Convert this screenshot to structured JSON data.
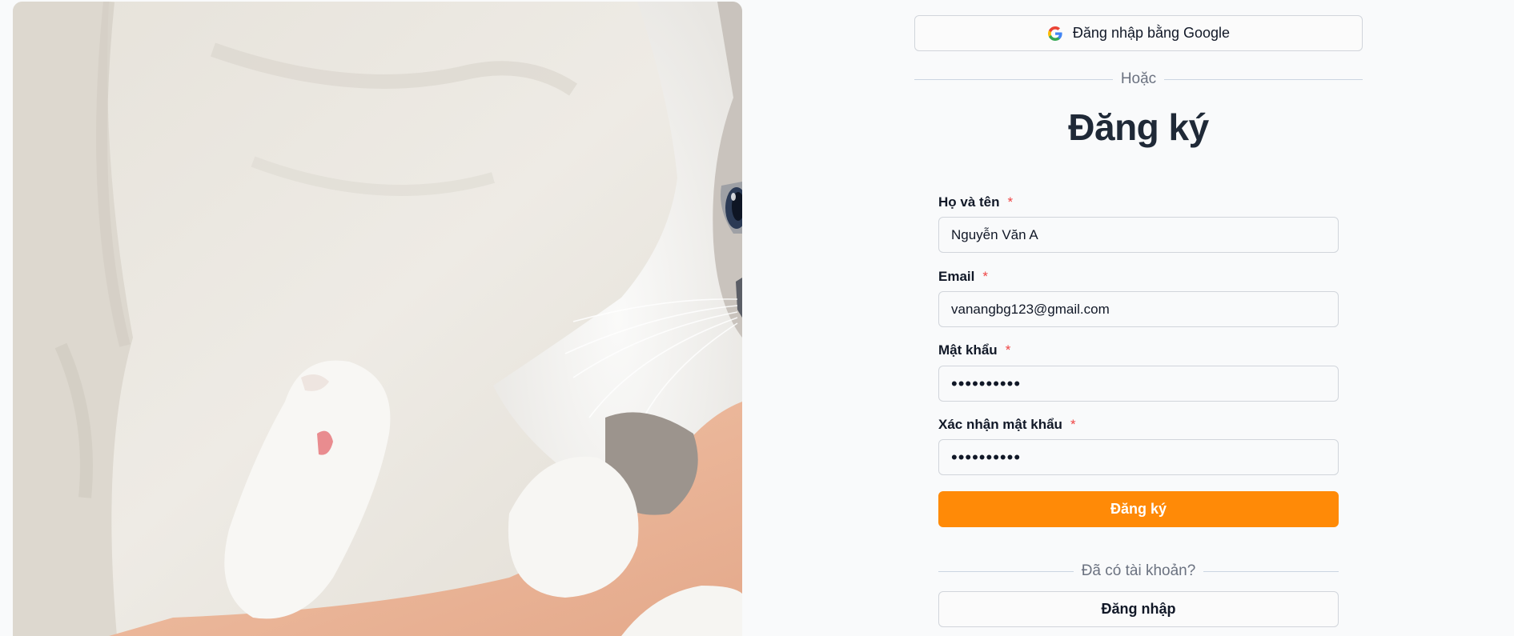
{
  "google_login": {
    "label": "Đăng nhập bằng Google",
    "icon": "google-icon"
  },
  "divider_or": "Hoặc",
  "title": "Đăng ký",
  "form": {
    "full_name": {
      "label": "Họ và tên",
      "required_mark": "*",
      "value": "Nguyễn Văn A"
    },
    "email": {
      "label": "Email",
      "required_mark": "*",
      "value": "vanangbg123@gmail.com"
    },
    "password": {
      "label": "Mật khẩu",
      "required_mark": "*",
      "value": "••••••••••"
    },
    "confirm_password": {
      "label": "Xác nhận mật khẩu",
      "required_mark": "*",
      "value": "••••••••••"
    },
    "submit_label": "Đăng ký"
  },
  "divider_account": "Đã có tài khoản?",
  "login_label": "Đăng nhập",
  "colors": {
    "accent": "#ff8a07",
    "required": "#ef4444",
    "border": "#d1d5db"
  }
}
